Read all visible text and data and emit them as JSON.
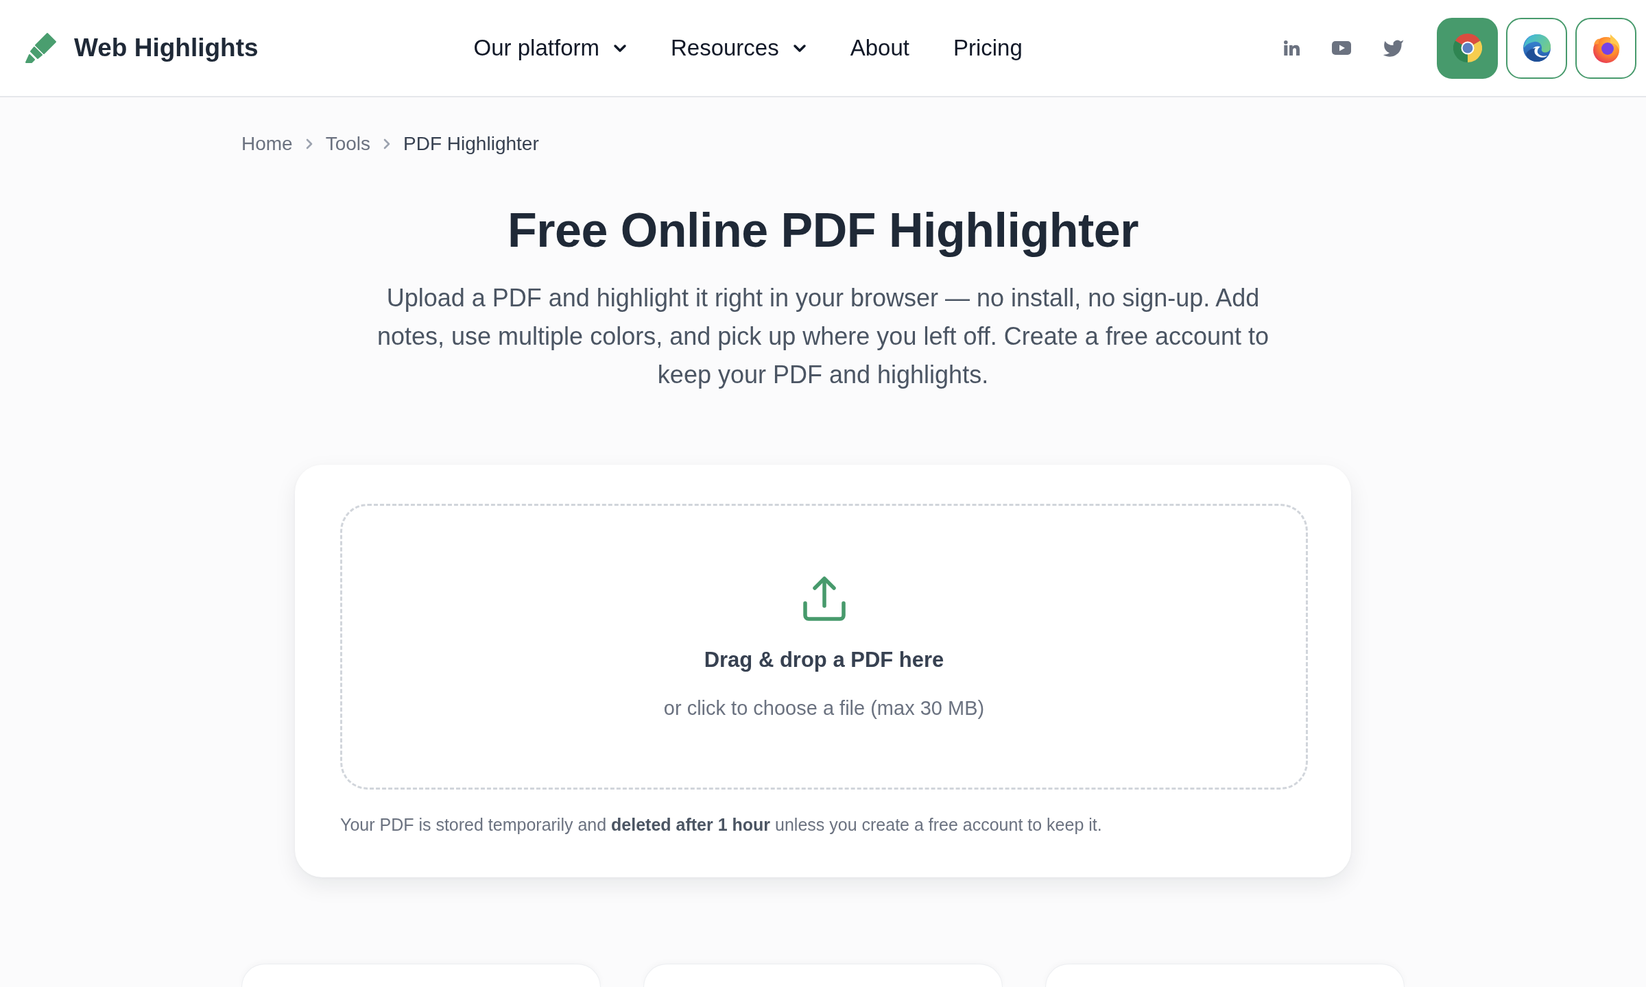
{
  "header": {
    "brand": "Web Highlights",
    "nav": [
      {
        "label": "Our platform",
        "kind": "dropdown"
      },
      {
        "label": "Resources",
        "kind": "dropdown"
      },
      {
        "label": "About",
        "kind": "link"
      },
      {
        "label": "Pricing",
        "kind": "link"
      }
    ],
    "social_links": [
      {
        "kind": "linkedin"
      },
      {
        "kind": "youtube"
      },
      {
        "kind": "twitter"
      }
    ],
    "browser_buttons": [
      {
        "kind": "chrome",
        "selected": true
      },
      {
        "kind": "edge",
        "selected": false
      },
      {
        "kind": "firefox",
        "selected": false
      }
    ]
  },
  "breadcrumb": [
    {
      "label": "Home",
      "current": false
    },
    {
      "label": "Tools",
      "current": false
    },
    {
      "label": "PDF Highlighter",
      "current": true
    }
  ],
  "hero": {
    "title": "Free Online PDF Highlighter",
    "description": "Upload a PDF and highlight it right in your browser — no install, no sign-up. Add notes, use multiple colors, and pick up where you left off. Create a free account to keep your PDF and highlights."
  },
  "upload": {
    "heading": "Drag & drop a PDF here",
    "hint": "or click to choose a file (max 30 MB)",
    "note": "Your PDF is stored temporarily and **deleted after 1 hour** unless you create a free account to keep it."
  }
}
